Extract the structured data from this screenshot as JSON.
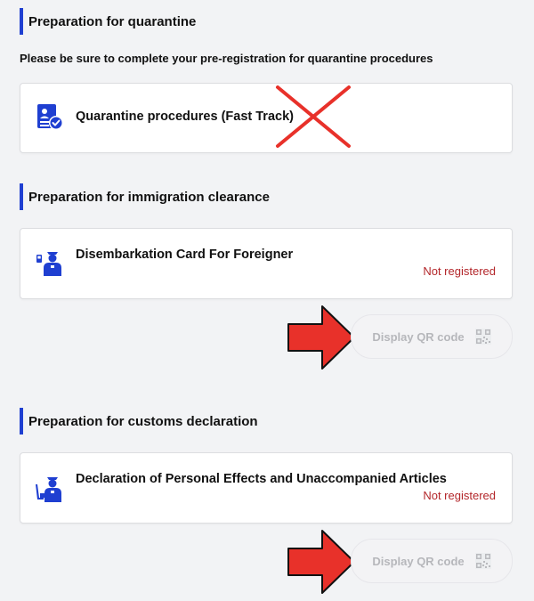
{
  "quarantine": {
    "heading": "Preparation for quarantine",
    "subtitle": "Please be sure to complete your pre-registration for quarantine procedures",
    "card": {
      "title": "Quarantine procedures (Fast Track)",
      "icon": "document-check-icon"
    }
  },
  "immigration": {
    "heading": "Preparation for immigration clearance",
    "card": {
      "title": "Disembarkation Card For Foreigner",
      "status": "Not registered",
      "icon": "immigration-officer-icon"
    },
    "qr_button": {
      "label": "Display QR code",
      "icon": "qr-code-icon"
    }
  },
  "customs": {
    "heading": "Preparation for customs declaration",
    "card": {
      "title": "Declaration of Personal Effects and Unaccompanied Articles",
      "status": "Not registered",
      "icon": "customs-officer-icon"
    },
    "qr_button": {
      "label": "Display QR code",
      "icon": "qr-code-icon"
    }
  },
  "colors": {
    "accent": "#1f3fd1",
    "status_red": "#b3262a",
    "annotation_red": "#e8312a",
    "background": "#f2f3f5"
  }
}
